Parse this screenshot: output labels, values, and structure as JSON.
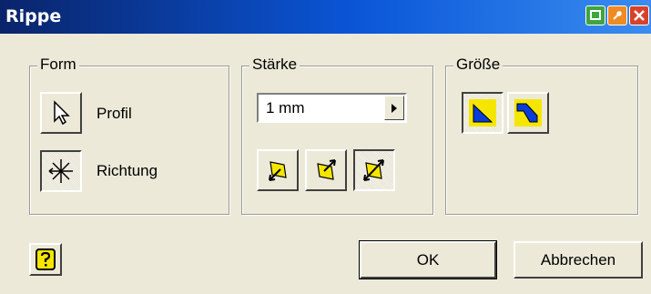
{
  "window": {
    "title": "Rippe",
    "title_buttons": [
      {
        "name": "green-icon",
        "color": "#3ea63e"
      },
      {
        "name": "orange-icon",
        "color": "#f08a24"
      },
      {
        "name": "close-icon",
        "color": "#d6432a"
      }
    ]
  },
  "form": {
    "legend": "Form",
    "profil_label": "Profil",
    "richtung_label": "Richtung",
    "profil_icon": "arrow-cursor-icon",
    "richtung_icon": "direction-star-icon",
    "richtung_pressed": true
  },
  "staerke": {
    "legend": "Stärke",
    "value": "1 mm",
    "direction_buttons": [
      {
        "icon": "thickness-side1-icon",
        "pressed": false
      },
      {
        "icon": "thickness-side2-icon",
        "pressed": false
      },
      {
        "icon": "thickness-symmetric-icon",
        "pressed": true
      }
    ]
  },
  "groesse": {
    "legend": "Größe",
    "buttons": [
      {
        "icon": "extent-to-next-icon",
        "pressed": true
      },
      {
        "icon": "extent-finite-icon",
        "pressed": false
      }
    ]
  },
  "footer": {
    "help_icon": "help-question-icon",
    "ok_label": "OK",
    "cancel_label": "Abbrechen"
  },
  "colors": {
    "face": "#ece9d8",
    "title_start": "#0a246a",
    "title_end": "#3a8cf0",
    "icon_yellow": "#f5e600",
    "icon_blue": "#0a3cd8"
  }
}
